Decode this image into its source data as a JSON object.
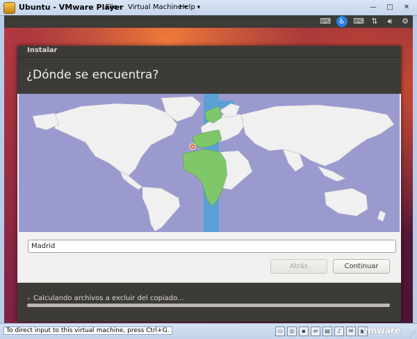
{
  "window": {
    "title": "Ubuntu - VMware Player",
    "menus": [
      "File",
      "Virtual Machine",
      "Help"
    ],
    "controls": [
      "—",
      "□",
      "✕"
    ]
  },
  "panel": {
    "icons": [
      "keyboard-icon",
      "accessibility-icon",
      "keyboard-layout-icon",
      "network-icon",
      "volume-icon",
      "settings-icon"
    ]
  },
  "installer": {
    "window_title": "Instalar",
    "heading": "¿Dónde se encuentra?",
    "city_input_value": "Madrid",
    "back_label": "Atrás",
    "continue_label": "Continuar",
    "status_text": "Calculando archivos a excluir del copiado..."
  },
  "map": {
    "ocean_color": "#9b9acf",
    "land_color": "#f0f0f0",
    "zone_highlight_color": "#5aa0d6",
    "selected_country_color": "#7fc86a"
  },
  "statusbar": {
    "hint": "To direct input to this virtual machine, press Ctrl+G.",
    "brand": "vmware"
  }
}
